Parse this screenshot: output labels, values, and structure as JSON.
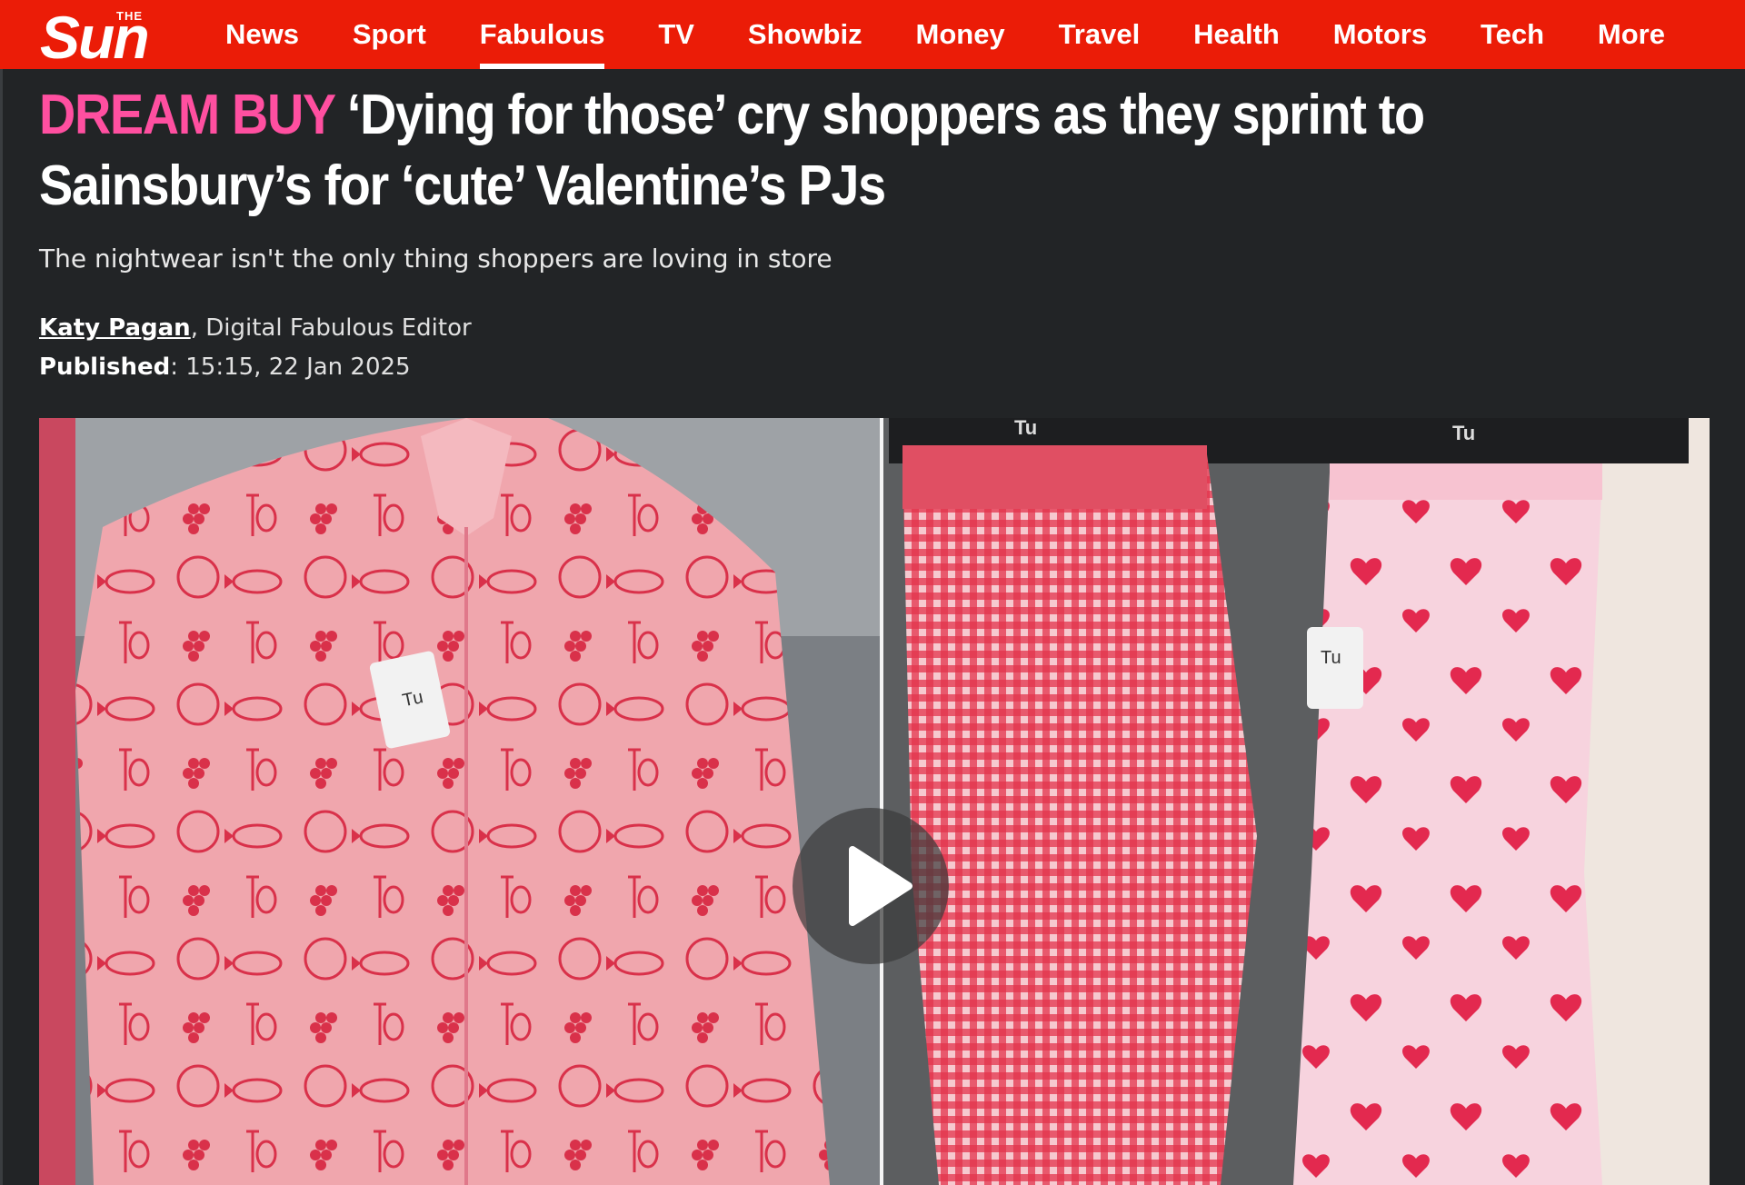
{
  "nav": {
    "logo_small": "THE",
    "logo_main": "Sun",
    "items": [
      {
        "label": "News"
      },
      {
        "label": "Sport"
      },
      {
        "label": "Fabulous",
        "active": true
      },
      {
        "label": "TV"
      },
      {
        "label": "Showbiz"
      },
      {
        "label": "Money"
      },
      {
        "label": "Travel"
      },
      {
        "label": "Health"
      },
      {
        "label": "Motors"
      },
      {
        "label": "Tech"
      },
      {
        "label": "More"
      }
    ]
  },
  "article": {
    "kicker": "DREAM BUY",
    "headline": "‘Dying for those’ cry shoppers as they sprint to Sainsbury’s for ‘cute’ Valentine’s PJs",
    "standfirst": "The nightwear isn't the only thing shoppers are loving in store",
    "author": "Katy Pagan",
    "author_role": ", Digital Fabulous Editor",
    "published_label": "Published",
    "published_value": ": 15:15, 22 Jan 2025"
  },
  "media": {
    "tag_text_left": "Tu",
    "hanger_text_mid": "Tu",
    "hanger_text_right": "Tu",
    "tag_text_right": "Tu",
    "play_icon": "play-icon"
  },
  "colors": {
    "nav_red": "#eb1c07",
    "page_bg": "#222426",
    "kicker_pink": "#ff4fa0"
  }
}
